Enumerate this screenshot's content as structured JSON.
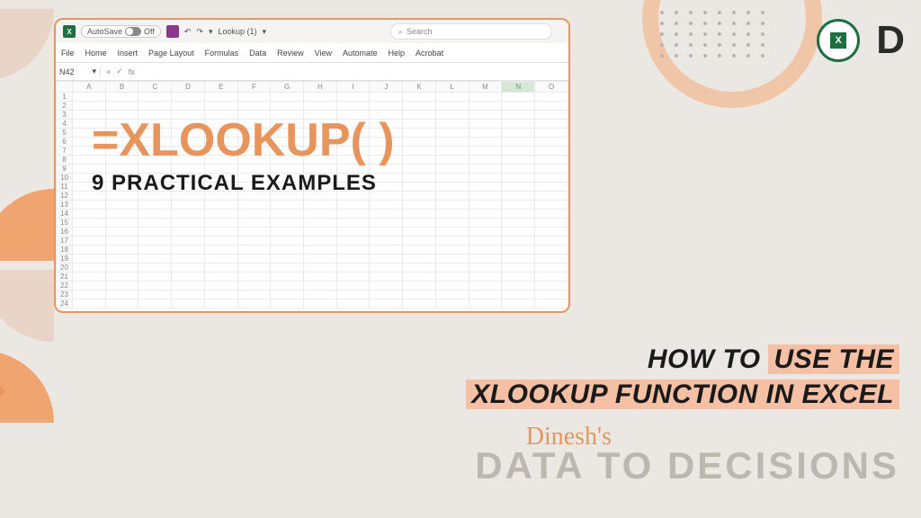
{
  "titlebar": {
    "autosave_label": "AutoSave",
    "autosave_state": "Off",
    "filename": "Lookup (1)",
    "search_placeholder": "Search"
  },
  "ribbon": {
    "tabs": [
      "File",
      "Home",
      "Insert",
      "Page Layout",
      "Formulas",
      "Data",
      "Review",
      "View",
      "Automate",
      "Help",
      "Acrobat"
    ]
  },
  "namebox": {
    "cell": "N42",
    "fx_label": "fx"
  },
  "grid": {
    "columns": [
      "A",
      "B",
      "C",
      "D",
      "E",
      "F",
      "G",
      "H",
      "I",
      "J",
      "K",
      "L",
      "M",
      "N",
      "O"
    ],
    "rows": 24,
    "selected_col": "N"
  },
  "overlay": {
    "formula_eq": "=",
    "formula_fn": "XLOOKUP",
    "formula_paren": "( )",
    "subtitle": "9 PRACTICAL EXAMPLES"
  },
  "headline": {
    "line1_prefix": "HOW TO",
    "line1_highlight": "USE THE",
    "line2_highlight": "XLOOKUP FUNCTION IN EXCEL",
    "signature": "Dinesh's",
    "brand": "DATA TO DECISIONS"
  },
  "logos": {
    "excel_letter": "X",
    "d_letter": "D"
  }
}
